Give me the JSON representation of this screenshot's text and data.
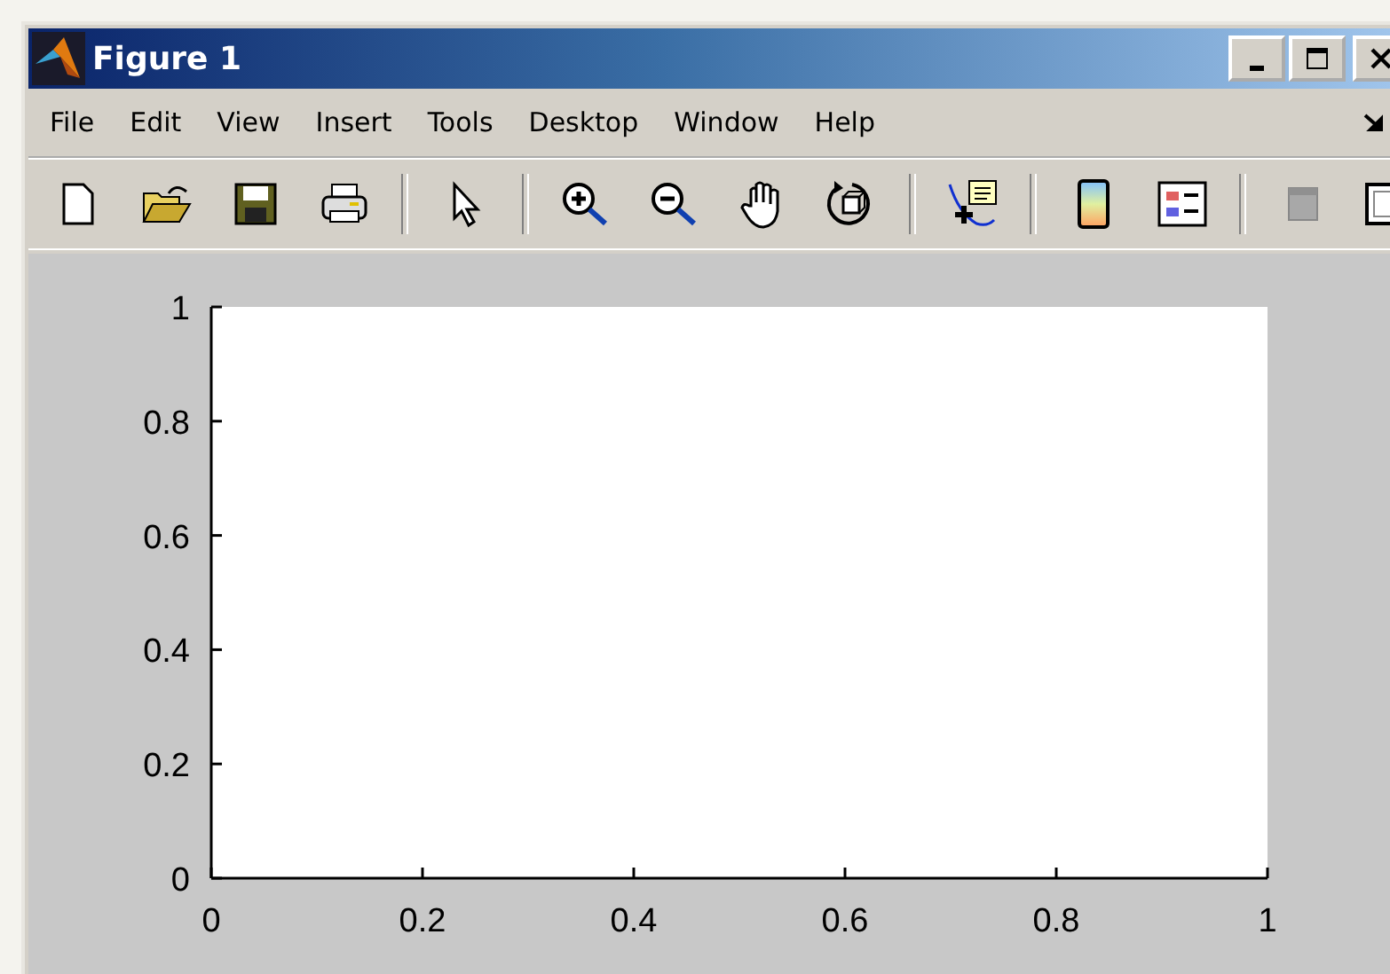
{
  "window": {
    "title": "Figure 1"
  },
  "menu": [
    "File",
    "Edit",
    "View",
    "Insert",
    "Tools",
    "Desktop",
    "Window",
    "Help"
  ],
  "axes": {
    "chart_data": {
      "type": "line",
      "xlim": [
        0,
        1
      ],
      "ylim": [
        0,
        1
      ],
      "xticks": [
        {
          "value": 0,
          "label": "0"
        },
        {
          "value": 0.2,
          "label": "0.2"
        },
        {
          "value": 0.4,
          "label": "0.4"
        },
        {
          "value": 0.6,
          "label": "0.6"
        },
        {
          "value": 0.8,
          "label": "0.8"
        },
        {
          "value": 1,
          "label": "1"
        }
      ],
      "yticks": [
        {
          "value": 0,
          "label": "0"
        },
        {
          "value": 0.2,
          "label": "0.2"
        },
        {
          "value": 0.4,
          "label": "0.4"
        },
        {
          "value": 0.6,
          "label": "0.6"
        },
        {
          "value": 0.8,
          "label": "0.8"
        },
        {
          "value": 1,
          "label": "1"
        }
      ]
    }
  }
}
